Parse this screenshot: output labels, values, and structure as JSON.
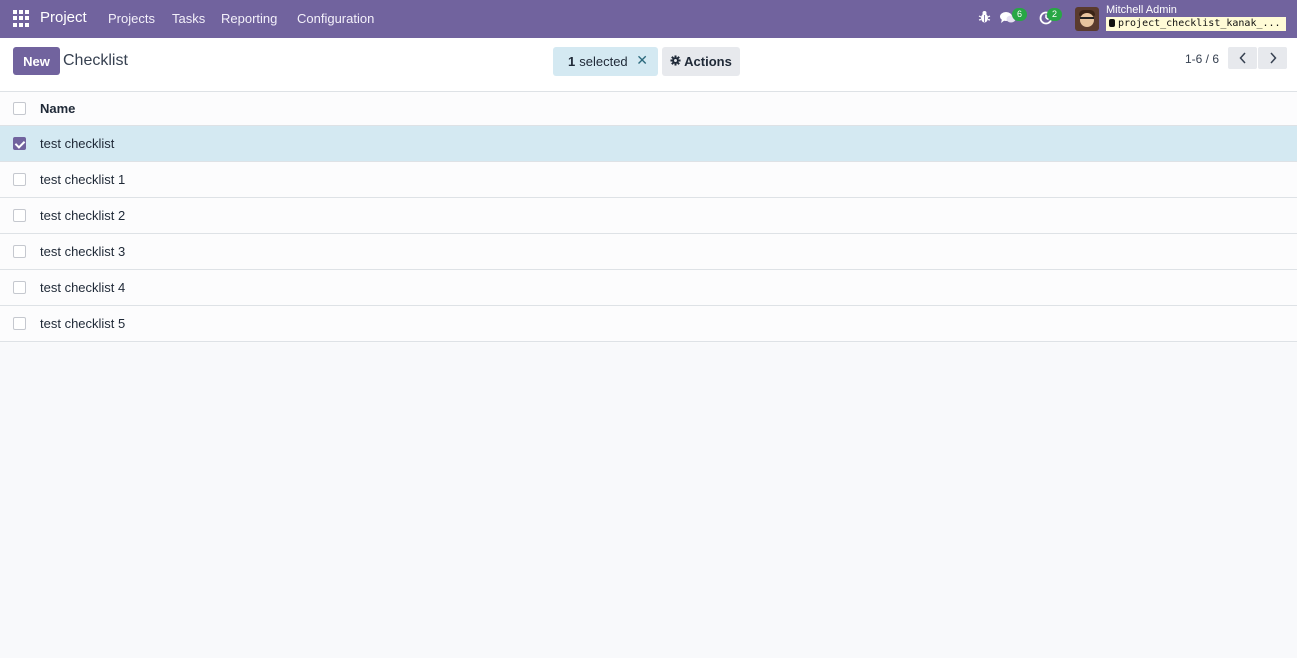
{
  "navbar": {
    "brand": "Project",
    "menu": [
      {
        "label": "Projects"
      },
      {
        "label": "Tasks"
      },
      {
        "label": "Reporting"
      },
      {
        "label": "Configuration"
      }
    ],
    "messages_count": "6",
    "activities_count": "2",
    "user_name": "Mitchell Admin",
    "database": "project_checklist_kanak_..."
  },
  "control_panel": {
    "new_label": "New",
    "title": "Checklist",
    "selected_count": "1",
    "selected_label": "selected",
    "close_glyph": "✕",
    "actions_label": "Actions",
    "pager_value": "1-6 / 6"
  },
  "list": {
    "column_name": "Name",
    "rows": [
      {
        "name": "test checklist",
        "selected": true
      },
      {
        "name": "test checklist 1",
        "selected": false
      },
      {
        "name": "test checklist 2",
        "selected": false
      },
      {
        "name": "test checklist 3",
        "selected": false
      },
      {
        "name": "test checklist 4",
        "selected": false
      },
      {
        "name": "test checklist 5",
        "selected": false
      }
    ]
  },
  "colors": {
    "brand": "#71639e",
    "selected_row": "#d4e9f2",
    "badge": "#28a745"
  },
  "icons": [
    "apps-grid-icon",
    "bug-icon",
    "chat-icon",
    "clock-icon",
    "gear-icon",
    "chevron-left-icon",
    "chevron-right-icon",
    "database-icon"
  ]
}
